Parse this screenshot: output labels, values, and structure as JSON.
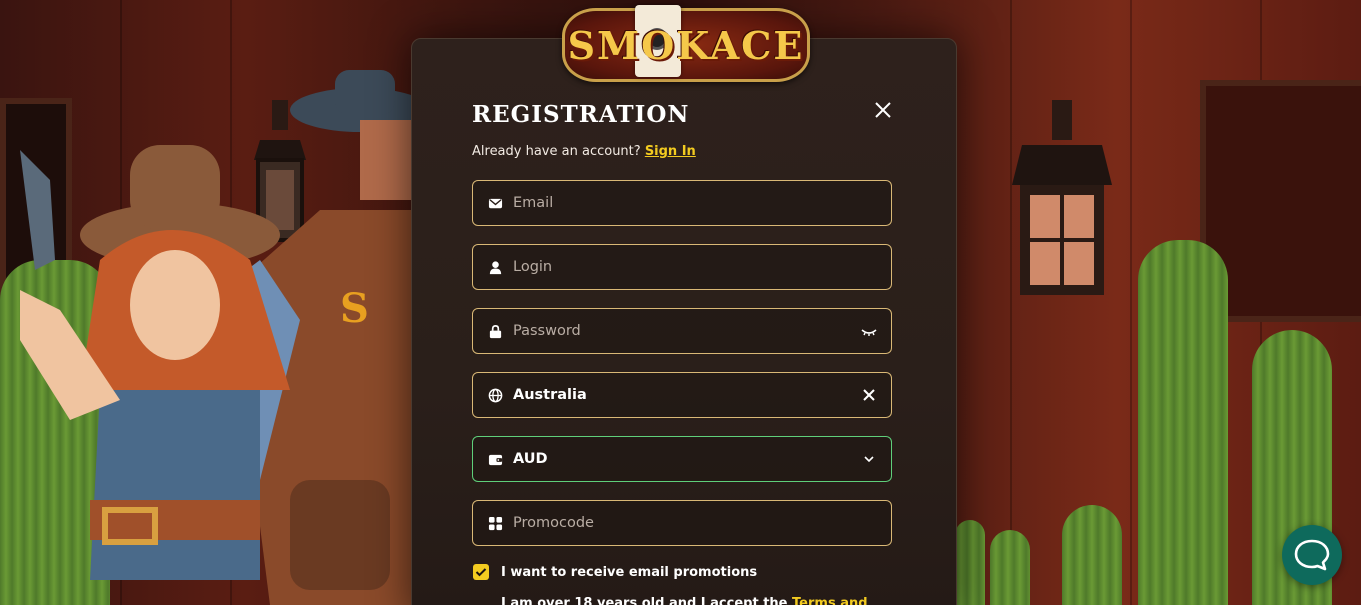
{
  "logo": {
    "text": "SMOKACE"
  },
  "modal": {
    "title": "REGISTRATION",
    "subtitle_text": "Already have an account?",
    "signin_link": "Sign In"
  },
  "fields": {
    "email": {
      "placeholder": "Email",
      "icon": "mail-icon"
    },
    "login": {
      "placeholder": "Login",
      "icon": "user-icon"
    },
    "password": {
      "placeholder": "Password",
      "icon": "lock-icon",
      "right_icon": "eye-closed-icon"
    },
    "country": {
      "value": "Australia",
      "icon": "globe-icon",
      "right_icon": "close-icon"
    },
    "currency": {
      "value": "AUD",
      "icon": "wallet-icon",
      "right_icon": "chevron-down-icon"
    },
    "promocode": {
      "placeholder": "Promocode",
      "icon": "gift-icon"
    }
  },
  "checkboxes": {
    "email_promotions": {
      "label": "I want to receive email promotions",
      "checked": true
    },
    "age_terms": {
      "label": "I am over 18 years old and I accept the",
      "link": "Terms and"
    }
  },
  "colors": {
    "accent": "#f3cb20",
    "field_border": "#d9b876",
    "active_border": "#5fcf7a",
    "modal_bg": "#2a1f1a",
    "chat_button": "#0e6a5c"
  },
  "chat": {
    "icon": "chat-bubble-icon"
  }
}
